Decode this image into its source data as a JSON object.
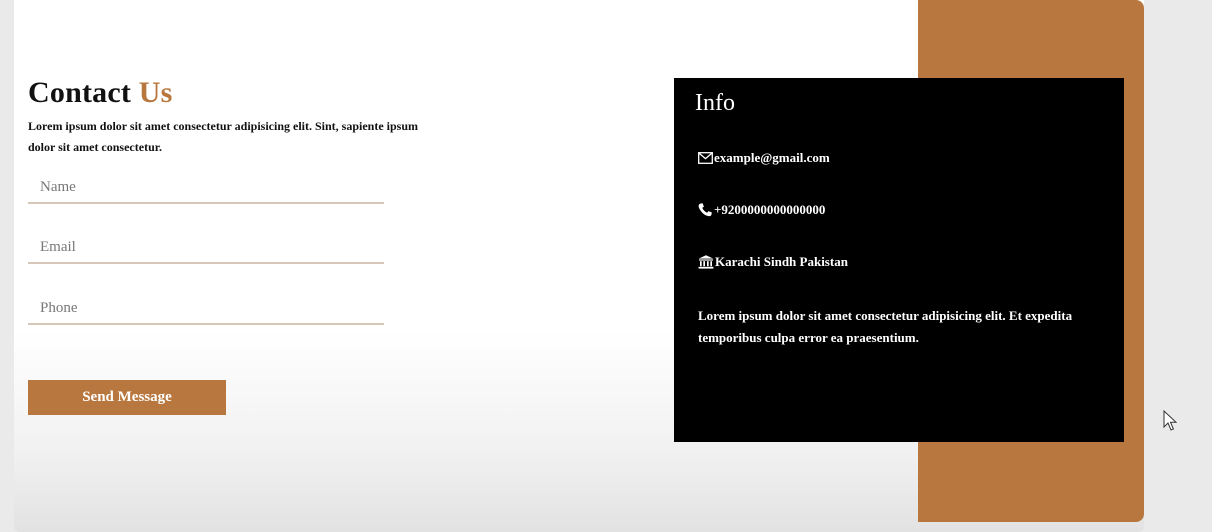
{
  "contact": {
    "title_main": "Contact",
    "title_accent": "Us",
    "description": "Lorem ipsum dolor sit amet consectetur adipisicing elit. Sint, sapiente ipsum dolor sit amet consectetur."
  },
  "form": {
    "name_placeholder": "Name",
    "email_placeholder": "Email",
    "phone_placeholder": "Phone",
    "send_label": "Send Message"
  },
  "info": {
    "title": "Info",
    "email": "example@gmail.com",
    "phone": "+9200000000000000",
    "address": "Karachi Sindh Pakistan",
    "text": "Lorem ipsum dolor sit amet consectetur adipisicing elit. Et expedita temporibus culpa error ea praesentium.",
    "email_icon": "envelope-icon",
    "phone_icon": "phone-icon",
    "address_icon": "bank-icon"
  },
  "colors": {
    "accent": "#b8773f",
    "panel": "#000000",
    "card": "#ffffff"
  }
}
